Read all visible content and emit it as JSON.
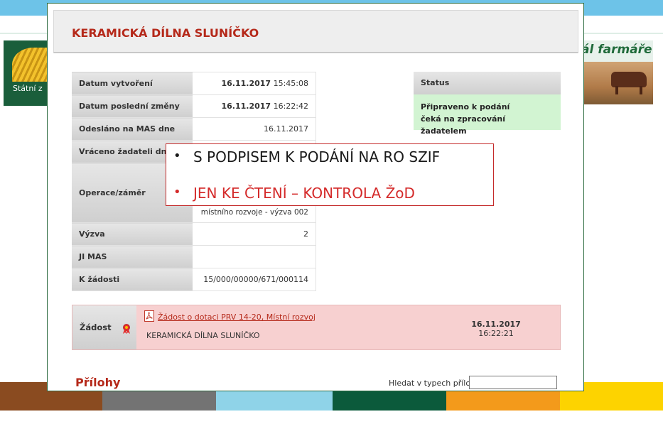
{
  "background": {
    "logo_text": "Státní z",
    "farm_text": "ál farmáře",
    "stripe_colors": [
      "#8a4b20",
      "#737373",
      "#8fd3e8",
      "#0b5a3b",
      "#f39a1b",
      "#fdd300"
    ]
  },
  "dialog": {
    "title": "KERAMICKÁ DÍLNA SLUNÍČKO",
    "info_rows": [
      {
        "label": "Datum vytvoření",
        "value_bold": "16.11.2017",
        "value": " 15:45:08"
      },
      {
        "label": "Datum poslední změny",
        "value_bold": "16.11.2017",
        "value": " 16:22:42"
      },
      {
        "label": "Odesláno na MAS dne",
        "value_bold": "",
        "value": "16.11.2017"
      },
      {
        "label": "Vráceno žadateli dne",
        "value_bold": "",
        "value": ""
      },
      {
        "label": "Operace/záměr",
        "value_bold": "",
        "value": "místního rozvoje - výzva 002"
      },
      {
        "label": "Výzva",
        "value_bold": "",
        "value": "2"
      },
      {
        "label": "JI MAS",
        "value_bold": "",
        "value": ""
      },
      {
        "label": "K žádosti",
        "value_bold": "",
        "value": "15/000/00000/671/000114"
      }
    ],
    "status": {
      "label": "Status",
      "line1": "Připraveno k podání",
      "line2": "čeká na zpracování žadatelem"
    },
    "zadost": {
      "label": "Žádost",
      "link": "Žádost o dotaci PRV 14-20, Místní rozvoj",
      "name": "KERAMICKÁ DÍLNA SLUNÍČKO",
      "date": "16.11.2017",
      "time": "16:22:21"
    },
    "prilohy": {
      "title": "Přílohy",
      "search_label": "Hledat v typech příloh:",
      "search_value": ""
    }
  },
  "overlay": {
    "items": [
      {
        "bullet": "•",
        "text": "S PODPISEM K PODÁNÍ NA RO SZIF",
        "color": "#1a1a1a"
      },
      {
        "bullet": "•",
        "text": "JEN KE ČTENÍ – KONTROLA ŽoD",
        "color": "#d42a2a"
      }
    ]
  },
  "colors": {
    "accent_red": "#b5291a",
    "status_green": "#d2f4d2",
    "zadost_pink": "#f7d0d0"
  }
}
